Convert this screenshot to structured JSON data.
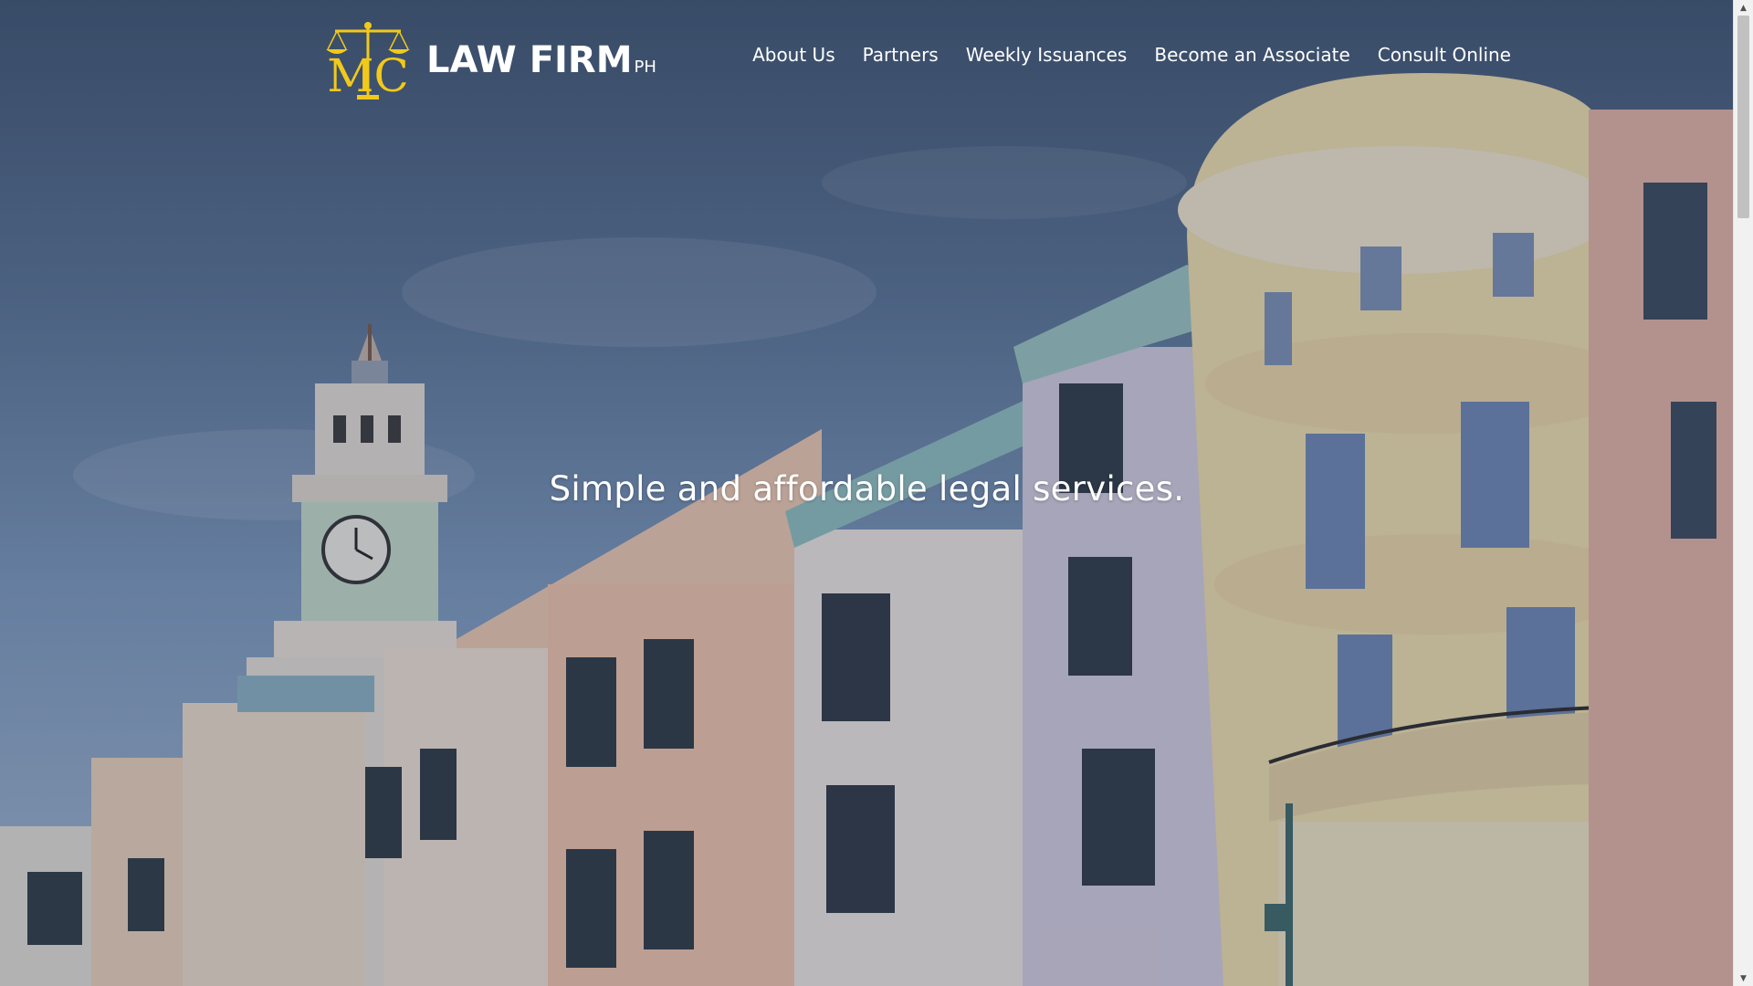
{
  "header": {
    "logo": {
      "monogram": "MC",
      "name": "LAW FIRM",
      "suffix": "PH",
      "accent_color": "#f2c91a"
    },
    "nav": [
      {
        "label": "About Us"
      },
      {
        "label": "Partners"
      },
      {
        "label": "Weekly Issuances"
      },
      {
        "label": "Become an Associate"
      },
      {
        "label": "Consult Online"
      }
    ]
  },
  "hero": {
    "tagline": "Simple and affordable legal services.",
    "background": "courthouse-building-photo"
  },
  "scrollbar": {
    "up_icon": "arrow-up-icon",
    "down_icon": "arrow-down-icon"
  }
}
